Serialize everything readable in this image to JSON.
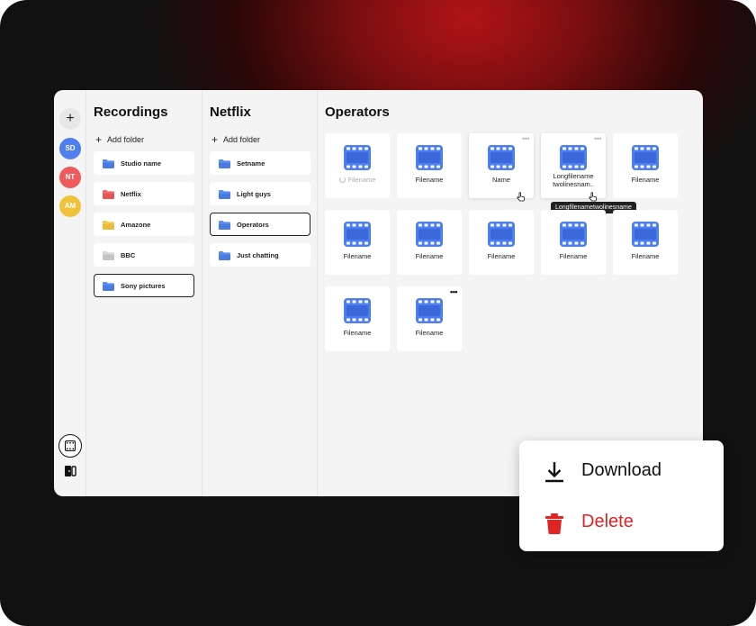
{
  "rail": {
    "add_label": "+",
    "avatars": [
      {
        "initials": "SD",
        "color": "#4f7ef0"
      },
      {
        "initials": "NT",
        "color": "#ef5a5a"
      },
      {
        "initials": "AM",
        "color": "#f0c23a"
      }
    ],
    "bottom_icons": [
      "film-icon",
      "exit-icon"
    ]
  },
  "recordings": {
    "title": "Recordings",
    "add_folder": "Add folder",
    "folders": [
      {
        "label": "Studio name",
        "color": "#5a8df0"
      },
      {
        "label": "Netflix",
        "color": "#ef6b6b"
      },
      {
        "label": "Amazone",
        "color": "#f2c94c"
      },
      {
        "label": "BBC",
        "color": "#cfcfcf"
      },
      {
        "label": "Sony pictures",
        "color": "#5a8df0"
      }
    ],
    "selected": "Sony pictures"
  },
  "netflix": {
    "title": "Netflix",
    "add_folder": "Add folder",
    "folders": [
      {
        "label": "Setname",
        "color": "#5a8df0"
      },
      {
        "label": "Light guys",
        "color": "#5a8df0"
      },
      {
        "label": "Operators",
        "color": "#5a8df0"
      },
      {
        "label": "Just chatting",
        "color": "#5a8df0"
      }
    ],
    "selected": "Operators"
  },
  "operators": {
    "title": "Operators",
    "files": [
      {
        "name": "Filename",
        "state": "loading"
      },
      {
        "name": "Filename"
      },
      {
        "name": "Name",
        "state": "hover"
      },
      {
        "name": "Longfilename twolinesnam..",
        "state": "hover"
      },
      {
        "name": "Filename"
      },
      {
        "name": "Filename"
      },
      {
        "name": "Filename"
      },
      {
        "name": "Filename"
      },
      {
        "name": "Filename"
      },
      {
        "name": "Filename"
      },
      {
        "name": "Filename"
      },
      {
        "name": "Filename",
        "state": "menu"
      }
    ],
    "tooltip": "Longfilenametwolinesname"
  },
  "context_menu": {
    "download": "Download",
    "delete": "Delete",
    "delete_color": "#e02424"
  },
  "colors": {
    "film_icon": "#4f7ef0",
    "accent_red": "#b11416"
  }
}
